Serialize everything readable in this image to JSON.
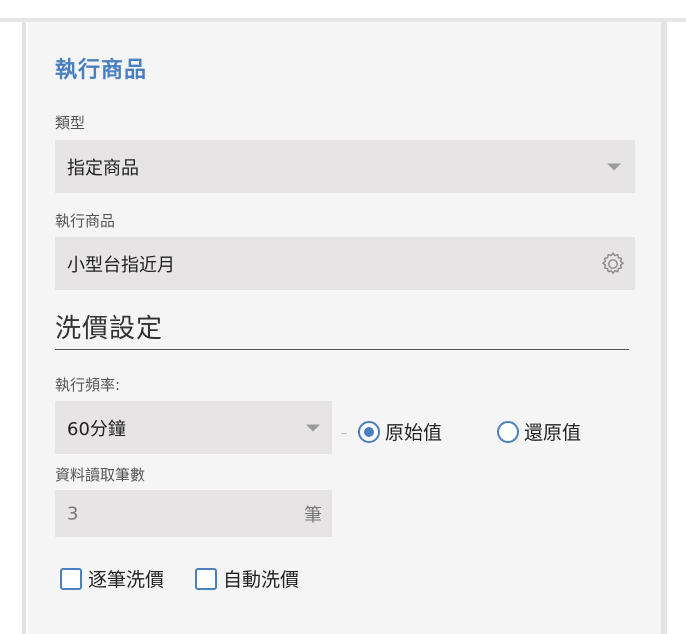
{
  "panel": {
    "heading": "執行商品"
  },
  "type_field": {
    "label": "類型",
    "value": "指定商品",
    "caret_icon": "chevron-down-icon"
  },
  "product_field": {
    "label": "執行商品",
    "value": "小型台指近月",
    "settings_icon": "gear-icon"
  },
  "wash_settings": {
    "title": "洗價設定",
    "frequency": {
      "label": "執行頻率:",
      "value": "60分鐘"
    },
    "price_mode": {
      "options": [
        "原始值",
        "還原值"
      ],
      "selected": "原始值"
    },
    "data_count": {
      "label": "資料讀取筆數",
      "value": "3",
      "unit": "筆"
    },
    "checkboxes": [
      {
        "label": "逐筆洗價",
        "checked": false
      },
      {
        "label": "自動洗價",
        "checked": false
      }
    ]
  },
  "colors": {
    "accent": "#4a7fc1",
    "field_bg": "#e6e4e4",
    "panel_bg": "#f5f5f5"
  }
}
